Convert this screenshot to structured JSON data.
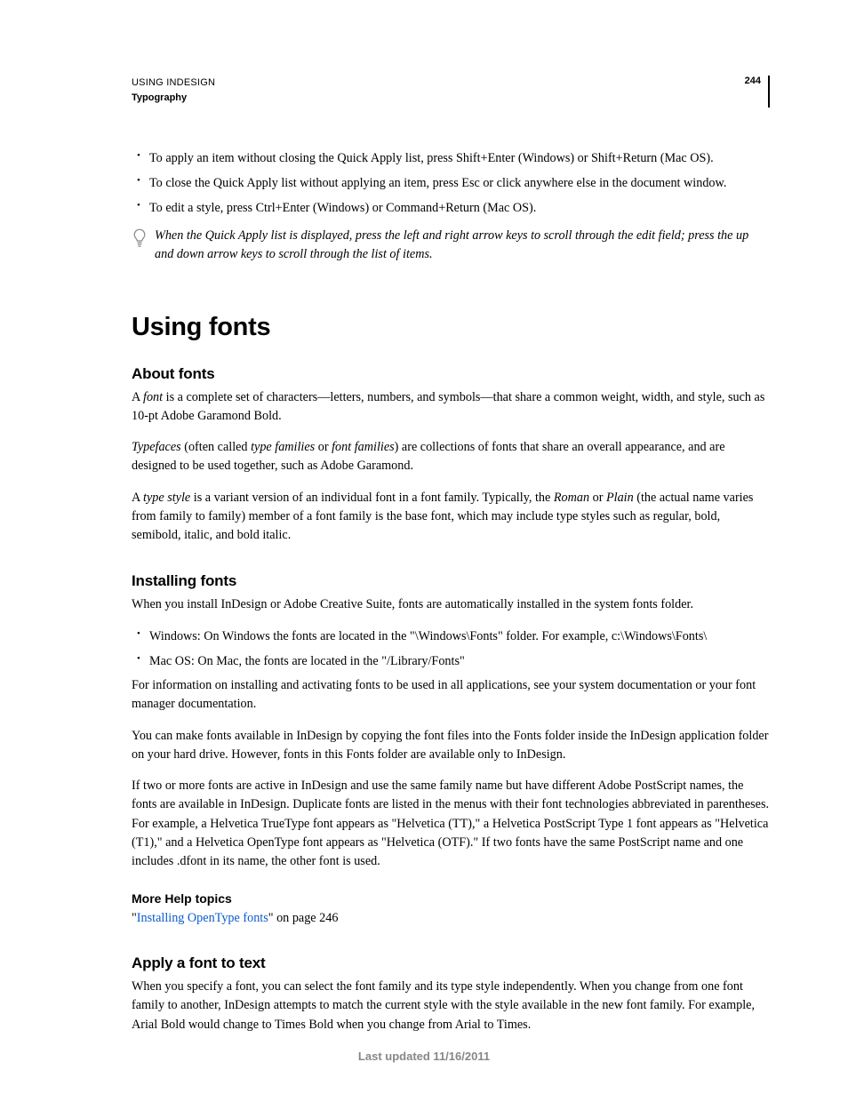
{
  "header": {
    "line1": "USING INDESIGN",
    "line2": "Typography",
    "pageNumber": "244"
  },
  "topList": [
    "To apply an item without closing the Quick Apply list, press Shift+Enter (Windows) or Shift+Return (Mac OS).",
    "To close the Quick Apply list without applying an item, press Esc or click anywhere else in the document window.",
    "To edit a style, press Ctrl+Enter (Windows) or Command+Return (Mac OS)."
  ],
  "tip": "When the Quick Apply list is displayed, press the left and right arrow keys to scroll through the edit field; press the up and down arrow keys to scroll through the list of items.",
  "chapterTitle": "Using fonts",
  "about": {
    "heading": "About fonts",
    "p1_a": "A ",
    "p1_em": "font",
    "p1_b": " is a complete set of characters—letters, numbers, and symbols—that share a common weight, width, and style, such as 10-pt Adobe Garamond Bold.",
    "p2_em1": "Typefaces",
    "p2_a": " (often called ",
    "p2_em2": "type families",
    "p2_b": " or ",
    "p2_em3": "font families",
    "p2_c": ") are collections of fonts that share an overall appearance, and are designed to be used together, such as Adobe Garamond.",
    "p3_a": "A ",
    "p3_em1": "type style",
    "p3_b": " is a variant version of an individual font in a font family. Typically, the ",
    "p3_em2": "Roman",
    "p3_c": " or ",
    "p3_em3": "Plain",
    "p3_d": " (the actual name varies from family to family) member of a font family is the base font, which may include type styles such as regular, bold, semibold, italic, and bold italic."
  },
  "installing": {
    "heading": "Installing fonts",
    "p1": "When you install InDesign or Adobe Creative Suite, fonts are automatically installed in the system fonts folder.",
    "bullets": [
      "Windows: On Windows the fonts are located in the \"\\Windows\\Fonts\" folder. For example, c:\\Windows\\Fonts\\",
      "Mac OS: On Mac, the fonts are located in the \"/Library/Fonts\""
    ],
    "p2": "For information on installing and activating fonts to be used in all applications, see your system documentation or your font manager documentation.",
    "p3": "You can make fonts available in InDesign by copying the font files into the Fonts folder inside the InDesign application folder on your hard drive. However, fonts in this Fonts folder are available only to InDesign.",
    "p4": "If two or more fonts are active in InDesign and use the same family name but have different Adobe PostScript names, the fonts are available in InDesign. Duplicate fonts are listed in the menus with their font technologies abbreviated in parentheses. For example, a Helvetica TrueType font appears as \"Helvetica (TT),\" a Helvetica PostScript Type 1 font appears as \"Helvetica (T1),\" and a Helvetica OpenType font appears as \"Helvetica (OTF).\" If two fonts have the same PostScript name and one includes .dfont in its name, the other font is used."
  },
  "moreHelp": {
    "heading": "More Help topics",
    "q1": "\"",
    "link": "Installing OpenType fonts",
    "q2": "\" on page 246"
  },
  "apply": {
    "heading": "Apply a font to text",
    "p1": "When you specify a font, you can select the font family and its type style independently. When you change from one font family to another, InDesign attempts to match the current style with the style available in the new font family. For example, Arial Bold would change to Times Bold when you change from Arial to Times."
  },
  "footer": "Last updated 11/16/2011"
}
